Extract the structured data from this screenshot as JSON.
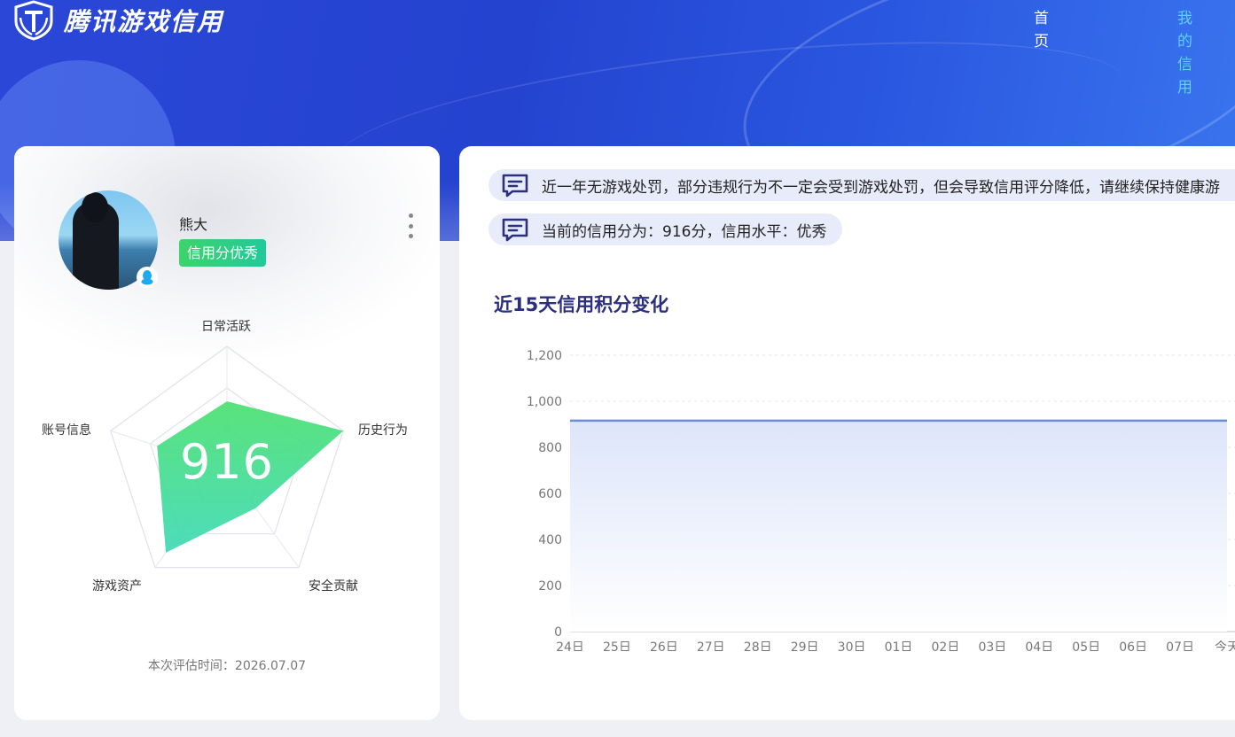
{
  "header": {
    "logo_text": "腾讯游戏信用",
    "nav": [
      {
        "label": "首页",
        "active": false
      },
      {
        "label": "我的信用",
        "active": true
      }
    ]
  },
  "profile": {
    "username": "熊大",
    "credit_tag": "信用分优秀",
    "score": "916",
    "eval_time": "本次评估时间：2026.07.07"
  },
  "radar": {
    "labels": {
      "daily": "日常活跃",
      "history": "历史行为",
      "security": "安全贡献",
      "assets": "游戏资产",
      "account": "账号信息"
    },
    "values": {
      "daily": 0.55,
      "history": 1.0,
      "security": 0.4,
      "assets": 0.85,
      "account": 0.6
    }
  },
  "notices": [
    "近一年无游戏处罚，部分违规行为不一定会受到游戏处罚，但会导致信用评分降低，请继续保持健康游",
    "当前的信用分为：916分，信用水平：优秀"
  ],
  "colors": {
    "accent": "#2443cf",
    "active_nav": "#5fd0ff",
    "radar_fill_top": "#4be070",
    "radar_fill_bottom": "#3ed9b6",
    "line": "#6e8fd8"
  },
  "chart_data": {
    "type": "area",
    "title": "近15天信用积分变化",
    "categories": [
      "24日",
      "25日",
      "26日",
      "27日",
      "28日",
      "29日",
      "30日",
      "01日",
      "02日",
      "03日",
      "04日",
      "05日",
      "06日",
      "07日",
      "今天"
    ],
    "series": [
      {
        "values": [
          916,
          916,
          916,
          916,
          916,
          916,
          916,
          916,
          916,
          916,
          916,
          916,
          916,
          916,
          916
        ]
      }
    ],
    "yticks": [
      "0",
      "200",
      "400",
      "600",
      "800",
      "1,000",
      "1,200"
    ],
    "ylim": [
      0,
      1200
    ],
    "grid": true
  }
}
